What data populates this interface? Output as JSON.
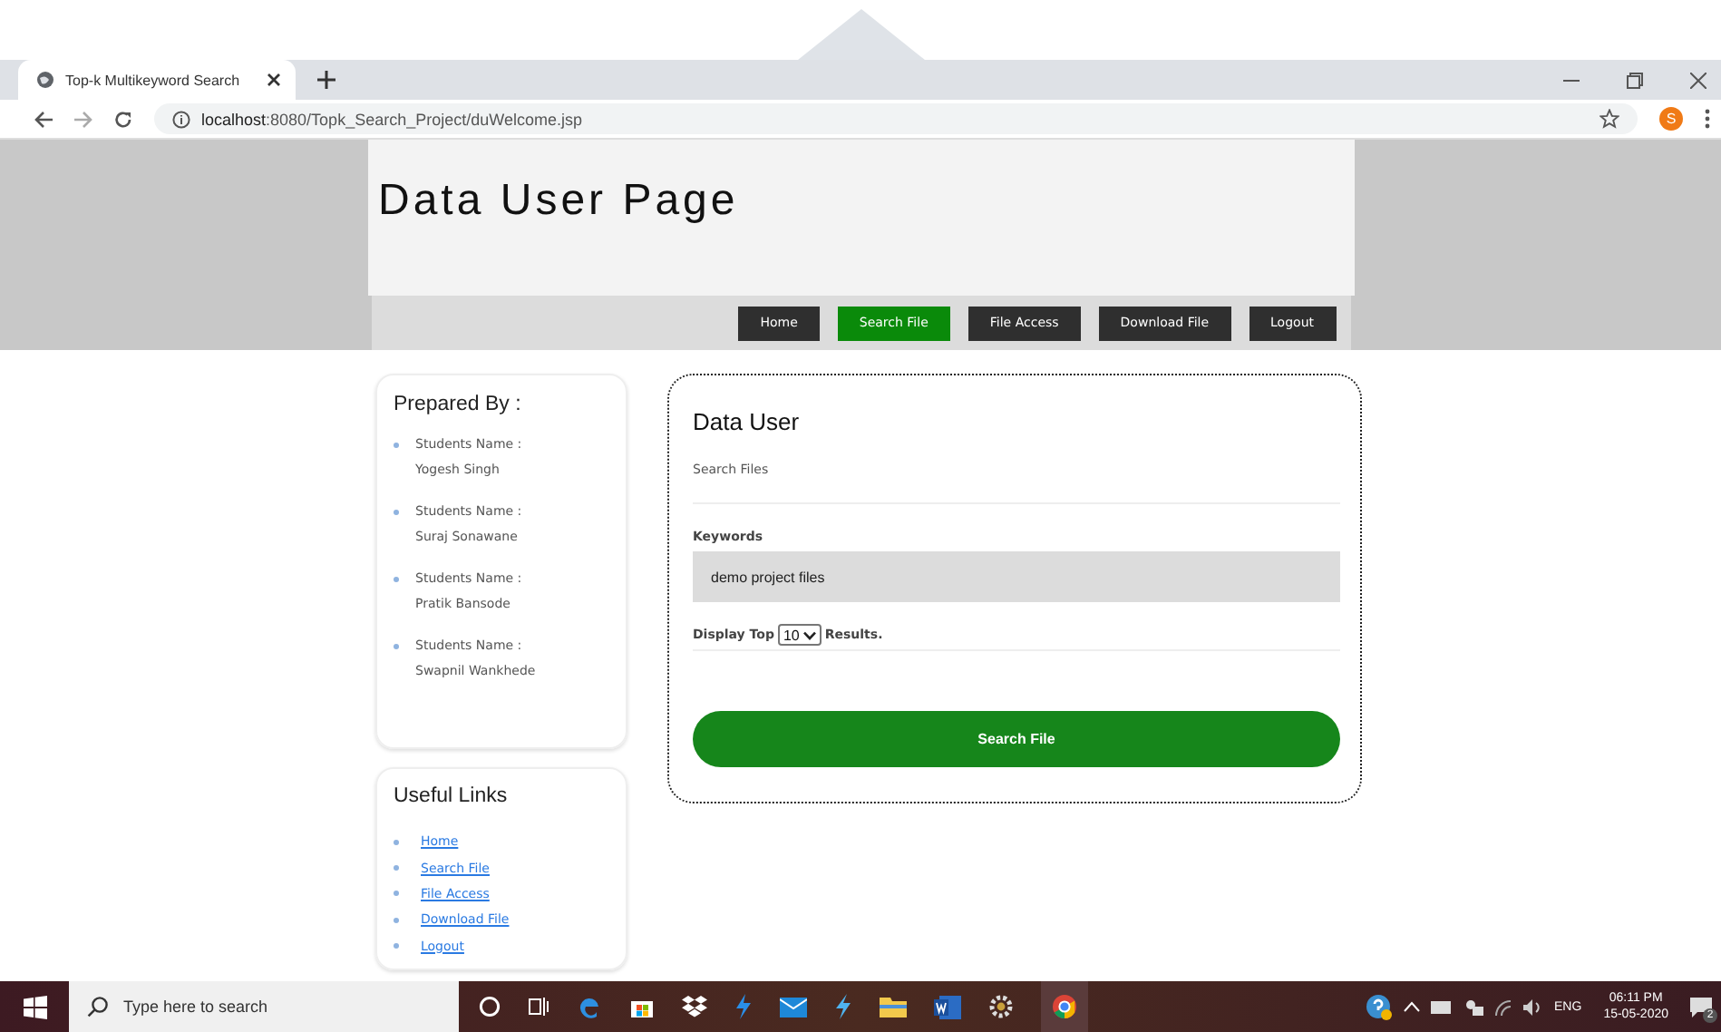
{
  "browser": {
    "tab_title": "Top-k Multikeyword Search",
    "url_host": "localhost",
    "url_rest": ":8080/Topk_Search_Project/duWelcome.jsp",
    "profile_initial": "S"
  },
  "header": {
    "title": "Data User Page"
  },
  "nav": [
    {
      "label": "Home",
      "selected": false
    },
    {
      "label": "Search File",
      "selected": true
    },
    {
      "label": "File Access",
      "selected": false
    },
    {
      "label": "Download File",
      "selected": false
    },
    {
      "label": "Logout",
      "selected": false
    }
  ],
  "prepared_by": {
    "title": "Prepared By :",
    "students": [
      {
        "label": "Students Name :",
        "name": "Yogesh Singh"
      },
      {
        "label": "Students Name :",
        "name": "Suraj Sonawane"
      },
      {
        "label": "Students Name :",
        "name": "Pratik Bansode"
      },
      {
        "label": "Students Name :",
        "name": "Swapnil Wankhede"
      }
    ]
  },
  "useful_links": {
    "title": "Useful Links",
    "links": [
      "Home",
      "Search File",
      "File Access",
      "Download File",
      "Logout"
    ]
  },
  "form": {
    "title": "Data User",
    "subtitle": "Search Files",
    "keywords_label": "Keywords",
    "keywords_value": "demo project files",
    "display_prefix": "Display Top",
    "top_value": "10",
    "display_suffix": "Results.",
    "submit": "Search File"
  },
  "taskbar": {
    "search_placeholder": "Type here to search",
    "language": "ENG",
    "time": "06:11 PM",
    "date": "15-05-2020",
    "notification_count": "2"
  }
}
